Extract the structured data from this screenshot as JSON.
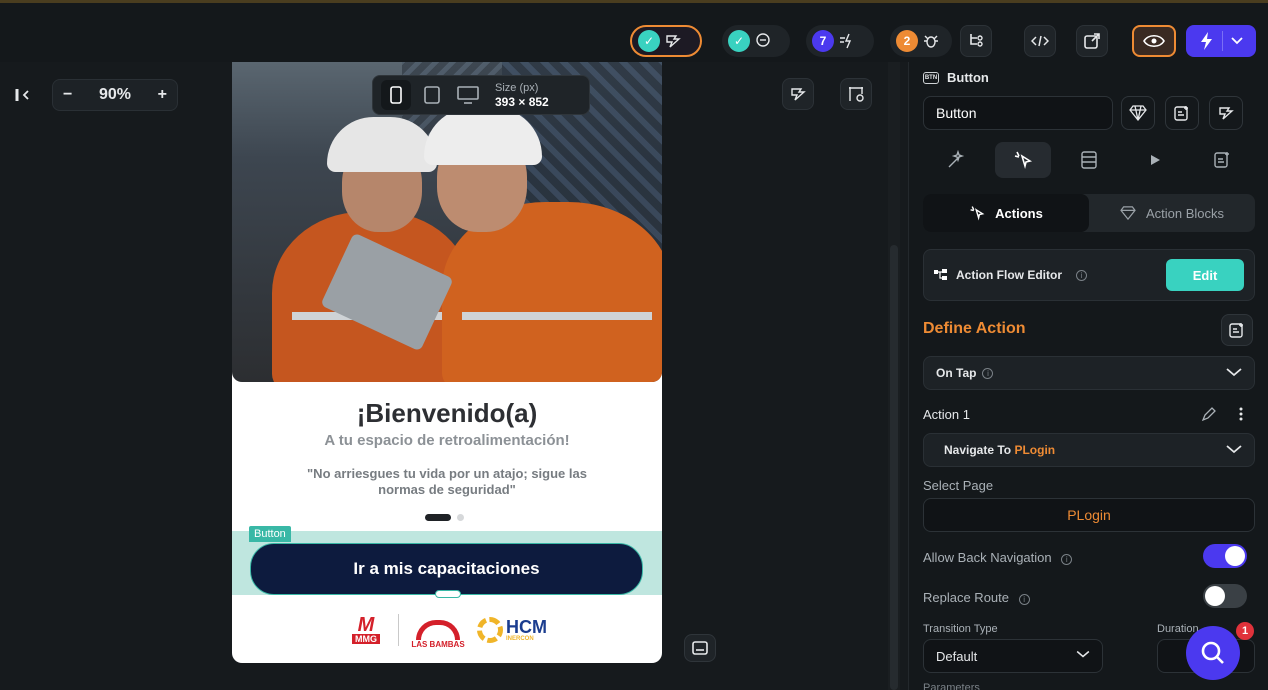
{
  "topbar": {
    "badge_1": "✓",
    "badge_2": "✓",
    "badge_3": "7",
    "badge_4": "2"
  },
  "canvas": {
    "zoom_minus": "−",
    "zoom_level": "90%",
    "zoom_plus": "+",
    "size_label": "Size (px)",
    "size_value": "393 × 852"
  },
  "app": {
    "welcome": "¡Bienvenido(a)",
    "subtitle": "A  tu espacio de retroalimentación!",
    "quote": "\"No arriesgues tu vida por un atajo; sigue las normas de seguridad\"",
    "button_tag": "Button",
    "button_label": "Ir a mis capacitaciones",
    "logo_mmg": "MMG",
    "logo_lasbambas": "LAS BAMBAS",
    "logo_hcm": "HCM",
    "logo_hcm_sub": "INERCON"
  },
  "panel": {
    "widget_type": "Button",
    "widget_name": "Button",
    "tab_actions": "Actions",
    "tab_blocks": "Action Blocks",
    "flow_editor": "Action Flow Editor",
    "edit": "Edit",
    "define_action": "Define Action",
    "trigger": "On Tap",
    "action_label": "Action 1",
    "navigate_prefix": "Navigate To ",
    "navigate_target": "PLogin",
    "select_page_label": "Select Page",
    "select_page_value": "PLogin",
    "allow_back": "Allow Back Navigation",
    "replace_route": "Replace Route",
    "transition_type_label": "Transition Type",
    "duration_label": "Duration",
    "transition_value": "Default",
    "parameters": "Parameters",
    "help_count": "1"
  },
  "colors": {
    "accent": "#4b39ef",
    "teal": "#39d2c0",
    "orange": "#ee8b34"
  }
}
